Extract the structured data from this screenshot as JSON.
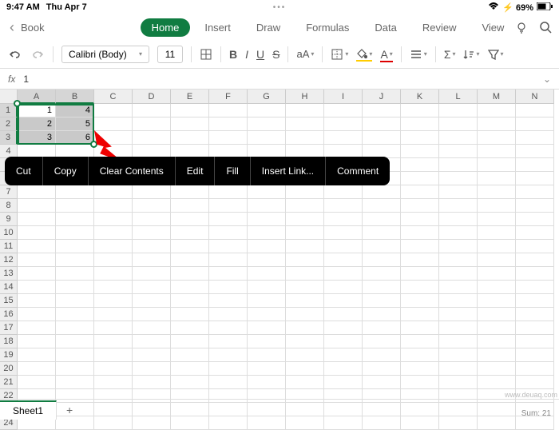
{
  "status": {
    "time": "9:47 AM",
    "date": "Thu Apr 7",
    "battery": "69%"
  },
  "doc": {
    "title": "Book"
  },
  "tabs": [
    "Home",
    "Insert",
    "Draw",
    "Formulas",
    "Data",
    "Review",
    "View"
  ],
  "active_tab": "Home",
  "ribbon": {
    "font": "Calibri (Body)",
    "size": "11"
  },
  "formula": {
    "label": "fx",
    "value": "1"
  },
  "columns": [
    "A",
    "B",
    "C",
    "D",
    "E",
    "F",
    "G",
    "H",
    "I",
    "J",
    "K",
    "L",
    "M",
    "N"
  ],
  "sel_cols": [
    "A",
    "B"
  ],
  "sel_rows": [
    1,
    2,
    3
  ],
  "cells": {
    "1": {
      "A": "1",
      "B": "4"
    },
    "2": {
      "A": "2",
      "B": "5"
    },
    "3": {
      "A": "3",
      "B": "6"
    }
  },
  "context_menu": [
    "Cut",
    "Copy",
    "Clear Contents",
    "Edit",
    "Fill",
    "Insert Link...",
    "Comment"
  ],
  "sheets": {
    "active": "Sheet1"
  },
  "footer": {
    "status": "Sum: 21"
  },
  "watermark": "www.deuaq.com",
  "colors": {
    "excel": "#107c41"
  }
}
